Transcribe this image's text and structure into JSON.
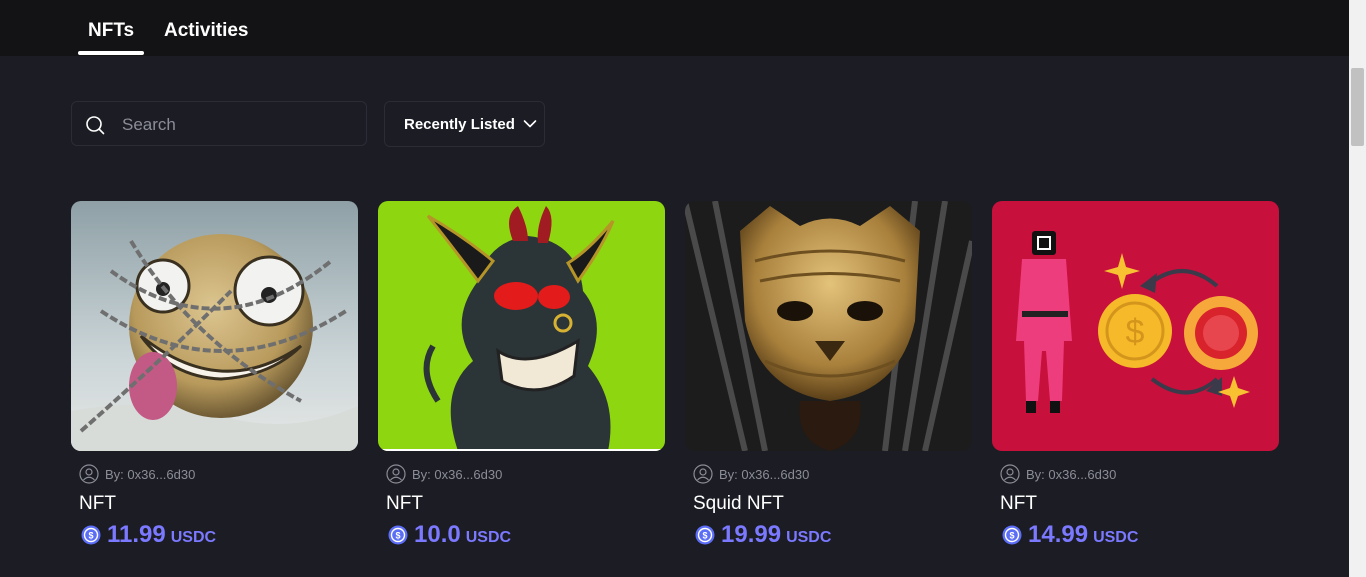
{
  "tabs": {
    "nfts": "NFTs",
    "activities": "Activities",
    "active": "nfts"
  },
  "search": {
    "placeholder": "Search",
    "value": ""
  },
  "sort": {
    "label": "Recently Listed",
    "icon": "chevron-down-icon"
  },
  "cards": [
    {
      "creator": "By: 0x36...6d30",
      "name": "NFT",
      "price": "11.99",
      "currency": "USDC",
      "image": "chained-smiley-ball"
    },
    {
      "creator": "By: 0x36...6d30",
      "name": "NFT",
      "price": "10.0",
      "currency": "USDC",
      "image": "horned-demon-ape"
    },
    {
      "creator": "By: 0x36...6d30",
      "name": "Squid NFT",
      "price": "19.99",
      "currency": "USDC",
      "image": "golden-tiger-mask"
    },
    {
      "creator": "By: 0x36...6d30",
      "name": "NFT",
      "price": "14.99",
      "currency": "USDC",
      "image": "squid-guard-coin-exchange"
    }
  ],
  "colors": {
    "background": "#1b1c24",
    "topbar": "#131315",
    "accent": "#7b79ff",
    "muted": "#8b8d97"
  }
}
